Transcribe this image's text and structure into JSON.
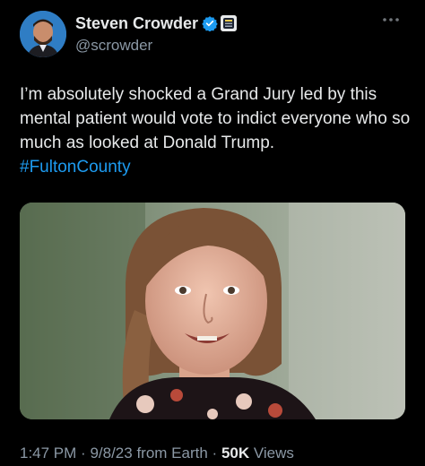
{
  "author": {
    "display_name": "Steven Crowder",
    "handle": "@scrowder",
    "verified_icon": "verified-badge-icon",
    "affiliate_icon": "affiliate-badge-icon",
    "colors": {
      "verified": "#1d9bf0",
      "name": "#e7e9ea",
      "handle": "#8b98a5"
    }
  },
  "menu": {
    "icon": "more-options-icon"
  },
  "tweet": {
    "text": "I’m absolutely shocked a Grand Jury led by this mental patient would vote to indict everyone who so much as looked at Donald Trump.",
    "hashtag": "#FultonCounty",
    "hashtag_color": "#1d9bf0"
  },
  "media": {
    "kind": "photo"
  },
  "meta": {
    "time": "1:47 PM",
    "date": "9/8/23",
    "source": "from Earth",
    "views_count": "50K",
    "views_label": "Views",
    "separator": "·"
  }
}
